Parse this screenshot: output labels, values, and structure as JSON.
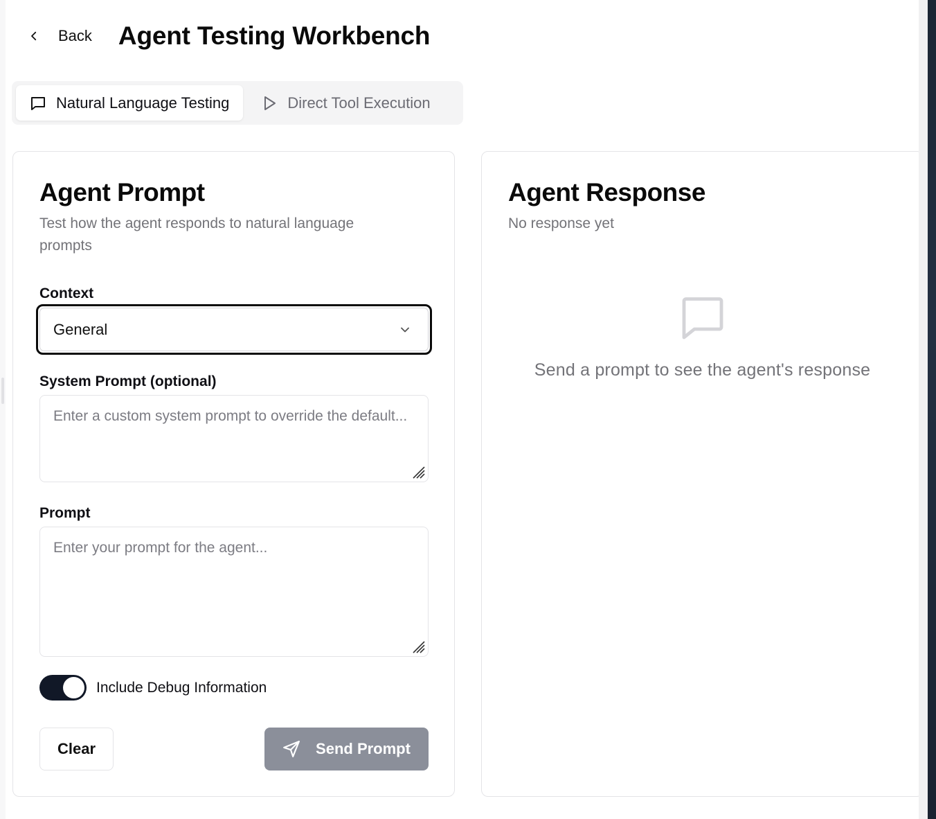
{
  "header": {
    "back_label": "Back",
    "title": "Agent Testing Workbench"
  },
  "tabs": [
    {
      "label": "Natural Language Testing",
      "icon": "message-square-icon",
      "active": true
    },
    {
      "label": "Direct Tool Execution",
      "icon": "play-icon",
      "active": false
    }
  ],
  "prompt_card": {
    "title": "Agent Prompt",
    "description": "Test how the agent responds to natural language prompts",
    "context_label": "Context",
    "context_value": "General",
    "system_prompt_label": "System Prompt (optional)",
    "system_prompt_placeholder": "Enter a custom system prompt to override the default...",
    "prompt_label": "Prompt",
    "prompt_placeholder": "Enter your prompt for the agent...",
    "debug_label": "Include Debug Information",
    "debug_enabled": true,
    "clear_label": "Clear",
    "send_label": "Send Prompt"
  },
  "response_card": {
    "title": "Agent Response",
    "status": "No response yet",
    "empty_message": "Send a prompt to see the agent's response"
  },
  "colors": {
    "toggle_on": "#111827",
    "send_button_disabled": "#8b8f9a",
    "muted_text": "#737378"
  }
}
